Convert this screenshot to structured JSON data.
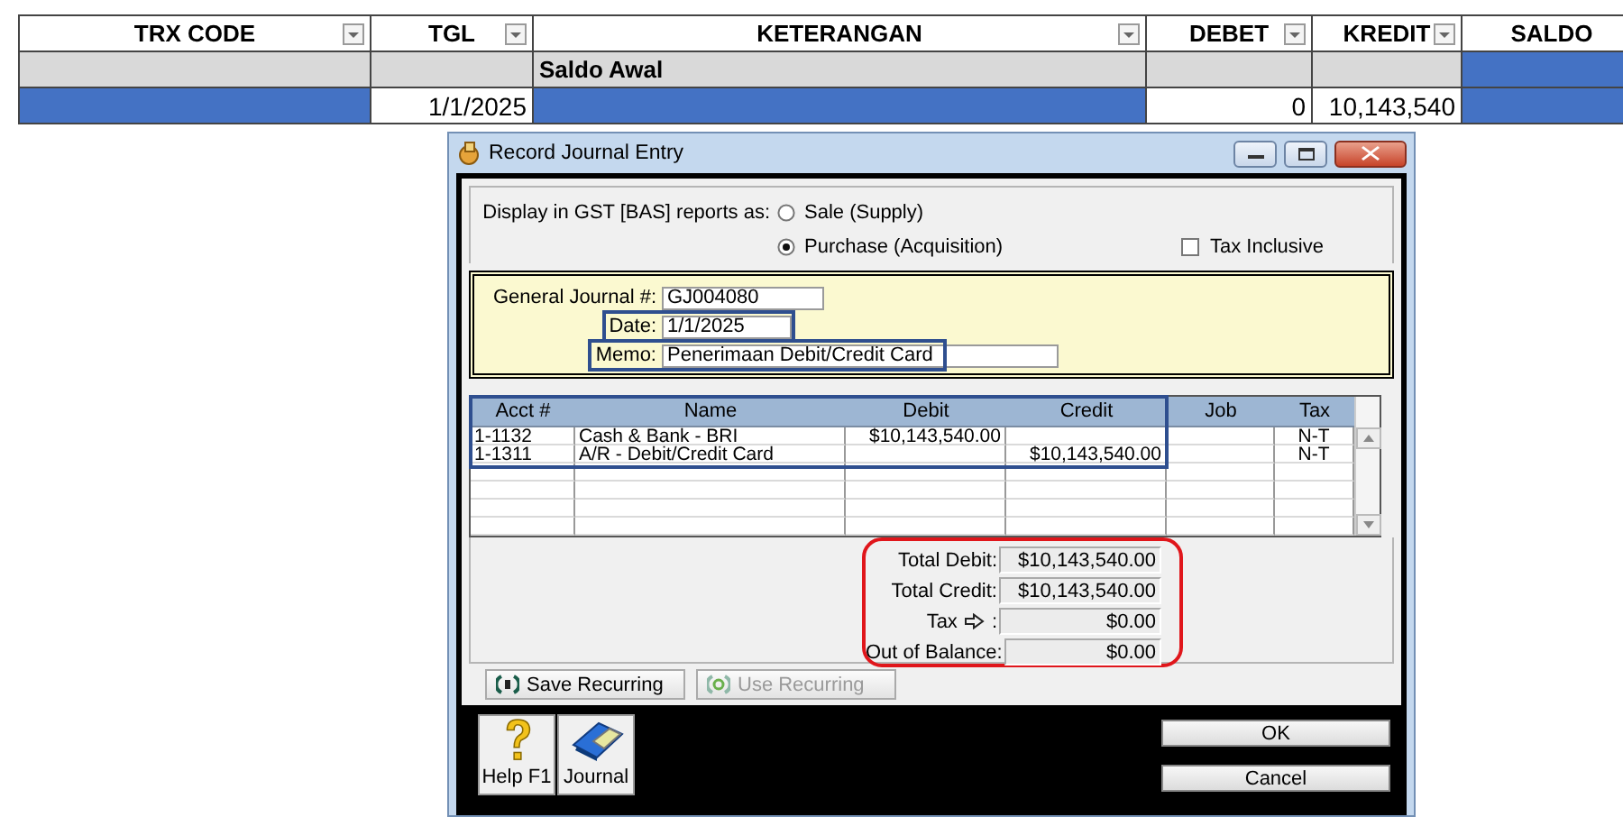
{
  "spreadsheet": {
    "columns": [
      {
        "label": "TRX CODE",
        "filter": true
      },
      {
        "label": "TGL",
        "filter": true
      },
      {
        "label": "KETERANGAN",
        "filter": true
      },
      {
        "label": "DEBET",
        "filter": true
      },
      {
        "label": "KREDIT",
        "filter": true
      },
      {
        "label": "SALDO",
        "filter": false
      }
    ],
    "rows": [
      {
        "shaded": true,
        "cells": [
          {
            "highlighted": false
          },
          {
            "highlighted": false
          },
          {
            "text": "Saldo Awal",
            "highlighted": false
          },
          {
            "highlighted": false
          },
          {
            "highlighted": false
          },
          {
            "highlighted": true
          }
        ]
      },
      {
        "shaded": false,
        "cells": [
          {
            "highlighted": true
          },
          {
            "text": "1/1/2025",
            "highlighted": false
          },
          {
            "highlighted": true
          },
          {
            "text": "0",
            "highlighted": false
          },
          {
            "text": "10,143,540",
            "highlighted": false
          },
          {
            "highlighted": true
          }
        ]
      }
    ]
  },
  "dialog": {
    "title": "Record Journal Entry",
    "gst": {
      "label": "Display in GST [BAS] reports as:",
      "options": [
        {
          "label": "Sale (Supply)",
          "selected": false
        },
        {
          "label": "Purchase (Acquisition)",
          "selected": true
        }
      ]
    },
    "tax_inclusive": {
      "label": "Tax Inclusive",
      "checked": false
    },
    "fields": [
      {
        "label": "General Journal #:",
        "value": "GJ004080",
        "annotated": false
      },
      {
        "label": "Date:",
        "value": "1/1/2025",
        "annotated": true
      },
      {
        "label": "Memo:",
        "value": "Penerimaan Debit/Credit Card",
        "annotated": true
      }
    ],
    "table": {
      "columns": [
        "Acct #",
        "Name",
        "Debit",
        "Credit",
        "Job",
        "Tax"
      ],
      "annotated": true,
      "rows": [
        {
          "acct": "1-1132",
          "name": "Cash & Bank - BRI",
          "debit": "$10,143,540.00",
          "tax": "N-T"
        },
        {
          "acct": "1-1311",
          "name": "A/R - Debit/Credit Card",
          "credit": "$10,143,540.00",
          "tax": "N-T"
        }
      ]
    },
    "totals": {
      "annotated": true,
      "items": [
        {
          "kind": "plain",
          "label": "Total Debit:",
          "value": "$10,143,540.00"
        },
        {
          "kind": "plain",
          "label": "Total Credit:",
          "value": "$10,143,540.00"
        },
        {
          "kind": "tax",
          "label": "Tax",
          "suffix": ":",
          "value": "$0.00"
        },
        {
          "kind": "plain",
          "label": "Out of Balance:",
          "value": "$0.00"
        }
      ]
    },
    "recurring": [
      {
        "label": "Save Recurring",
        "disabled": false
      },
      {
        "label": "Use Recurring",
        "disabled": true
      }
    ],
    "tools": [
      {
        "kind": "help",
        "label": "Help F1"
      },
      {
        "kind": "journal",
        "label": "Journal"
      }
    ],
    "actions": [
      "OK",
      "Cancel"
    ]
  }
}
